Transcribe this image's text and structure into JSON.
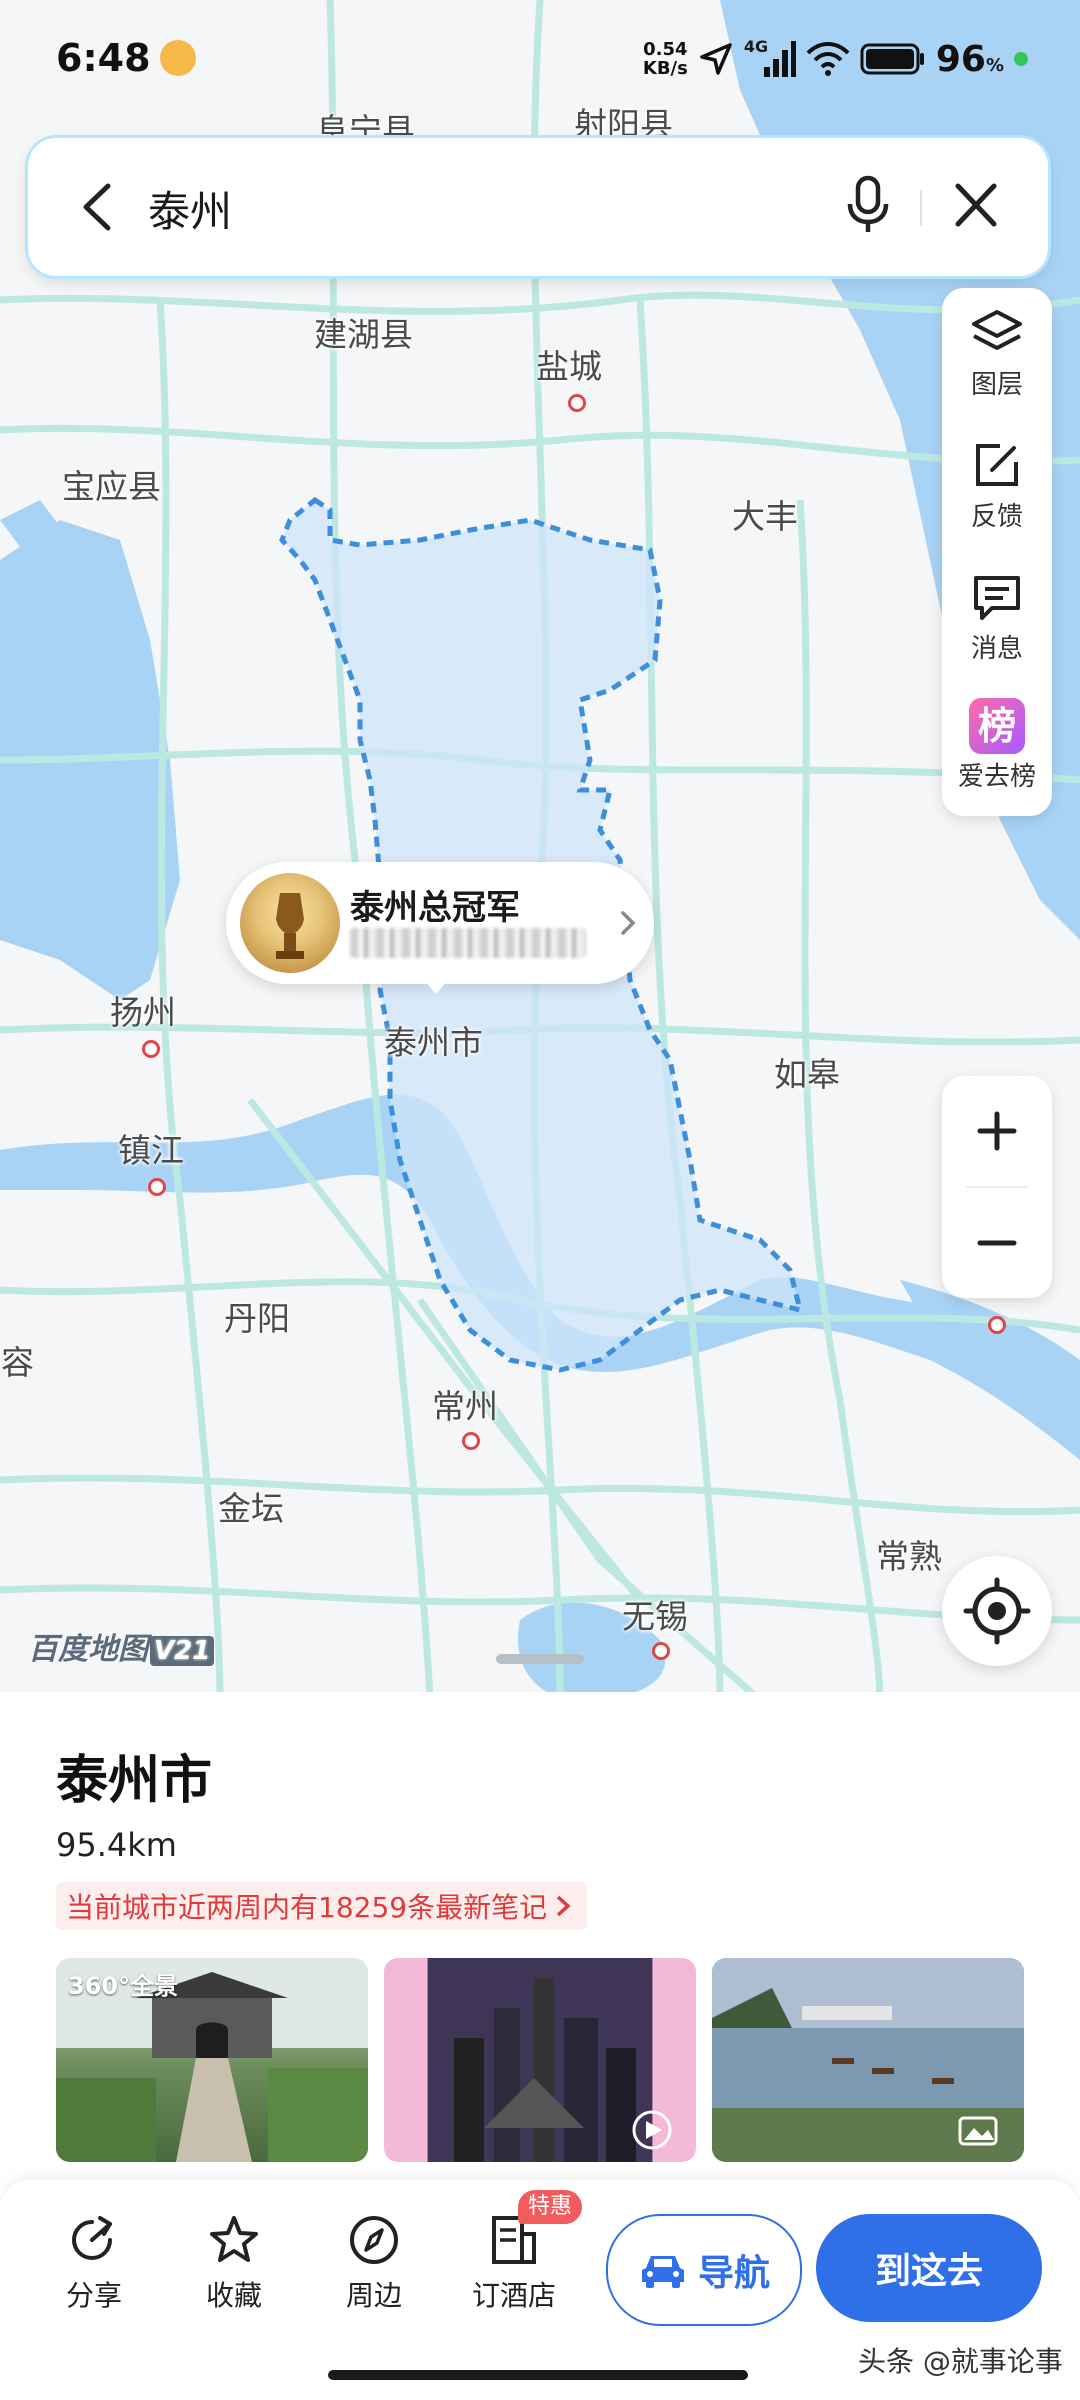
{
  "status_bar": {
    "time": "6:48",
    "net_speed_value": "0.54",
    "net_speed_unit": "KB/s",
    "network_type": "4G",
    "battery": "96",
    "battery_unit": "%"
  },
  "search": {
    "query": "泰州",
    "icons": [
      "back-arrow-icon",
      "microphone-icon",
      "close-icon"
    ]
  },
  "map": {
    "places": {
      "fuNing": "阜宁县",
      "sheYang": "射阳县",
      "jianHu": "建湖县",
      "yanCheng": "盐城",
      "baoYing": "宝应县",
      "daFeng": "大丰",
      "yangZhou": "扬州",
      "taiZhou": "泰州市",
      "ruGao": "如皋",
      "zhenJiang": "镇江",
      "danYang": "丹阳",
      "jurong": "句容",
      "changZhou": "常州",
      "jinTan": "金坛",
      "changShu": "常熟",
      "wuXi": "无锡"
    },
    "logo": "百度地图",
    "logo_version": "V21",
    "colors": {
      "water": "#a9d3f5",
      "road": "#bde8e2",
      "boundary": "#3d8fdc",
      "region_fill": "#cfe4fa"
    }
  },
  "tools": [
    {
      "label": "图层",
      "icon": "layers-icon"
    },
    {
      "label": "反馈",
      "icon": "feedback-icon"
    },
    {
      "label": "消息",
      "icon": "message-icon"
    },
    {
      "label": "爱去榜",
      "icon": "ranking-icon",
      "glyph": "榜"
    }
  ],
  "poi_bubble": {
    "title": "泰州总冠军"
  },
  "sheet": {
    "title": "泰州市",
    "distance": "95.4km",
    "notes_link": "当前城市近两周内有18259条最新笔记",
    "pano_badge": "全景",
    "pano_prefix": "360°"
  },
  "actions": {
    "share": "分享",
    "favorite": "收藏",
    "nearby": "周边",
    "hotel": "订酒店",
    "hotel_badge": "特惠",
    "navigate": "导航",
    "go_here": "到这去"
  },
  "watermark": "头条 @就事论事",
  "accent_color": "#2f6fe8"
}
